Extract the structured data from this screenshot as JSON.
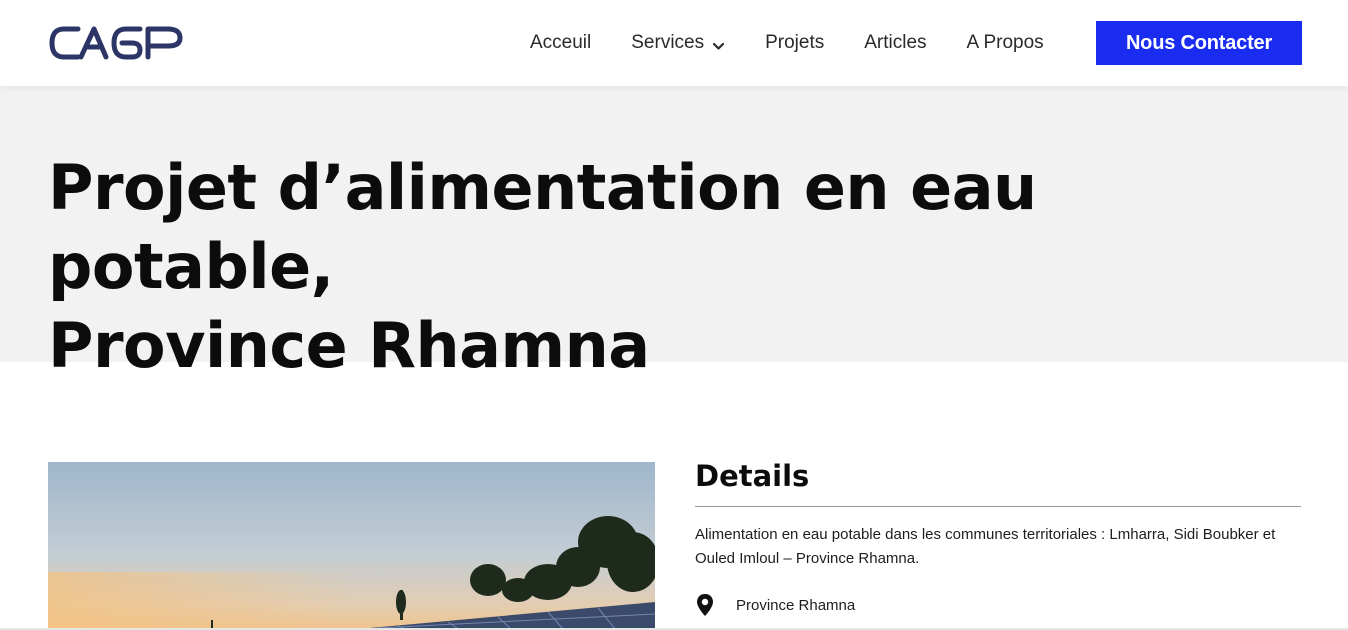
{
  "header": {
    "logo_text": "CAGP",
    "nav": [
      {
        "label": "Acceuil"
      },
      {
        "label": "Services",
        "has_dropdown": true
      },
      {
        "label": "Projets"
      },
      {
        "label": "Articles"
      },
      {
        "label": "A Propos"
      }
    ],
    "cta_label": "Nous Contacter"
  },
  "hero": {
    "title_line1": "Projet d’alimentation en eau potable,",
    "title_line2": "Province Rhamna"
  },
  "project_image": {
    "alt": "solar-panels-installation-photo"
  },
  "details": {
    "title": "Details",
    "description": "Alimentation en eau potable dans les communes territoriales : Lmharra, Sidi Boubker et Ouled Imloul – Province Rhamna.",
    "location": "Province Rhamna",
    "location_icon": "map-pin-icon"
  },
  "colors": {
    "accent": "#1a2cf0",
    "logo": "#2d3566",
    "hero_bg": "#f2f2f2"
  }
}
